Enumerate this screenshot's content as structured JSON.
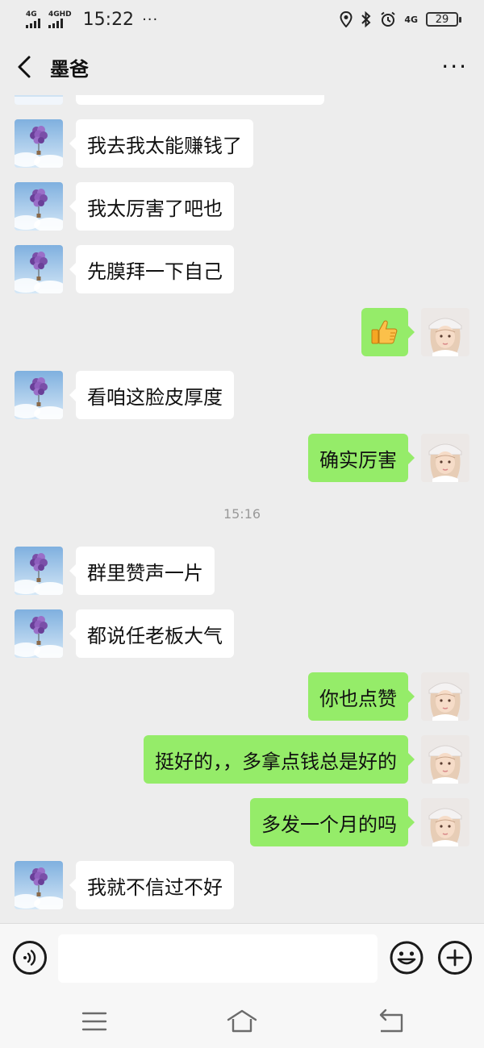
{
  "status_bar": {
    "signal1_label": "4G",
    "signal2_label": "4GHD",
    "time": "15:22",
    "overflow": "···",
    "network_label": "4G",
    "battery": "29"
  },
  "header": {
    "title": "墨爸",
    "more_label": "···"
  },
  "messages": [
    {
      "side": "left",
      "text": "我去我太能赚钱了"
    },
    {
      "side": "left",
      "text": "我太厉害了吧也"
    },
    {
      "side": "left",
      "text": "先膜拜一下自己"
    },
    {
      "side": "right",
      "type": "emoji",
      "text": "👍"
    },
    {
      "side": "left",
      "text": "看咱这脸皮厚度"
    },
    {
      "side": "right",
      "text": "确实厉害"
    },
    {
      "type": "timestamp",
      "text": "15:16"
    },
    {
      "side": "left",
      "text": "群里赞声一片"
    },
    {
      "side": "left",
      "text": "都说任老板大气"
    },
    {
      "side": "right",
      "text": "你也点赞"
    },
    {
      "side": "right",
      "text": "挺好的，，多拿点钱总是好的"
    },
    {
      "side": "right",
      "text": "多发一个月的吗"
    },
    {
      "side": "left",
      "text": "我就不信过不好"
    }
  ],
  "input_bar": {
    "value": "",
    "placeholder": ""
  },
  "icons": {
    "left_avatar": "balloon-avatar",
    "right_avatar": "girl-avatar"
  },
  "colors": {
    "sent_bubble": "#95ec69",
    "received_bubble": "#ffffff",
    "background": "#ededed"
  }
}
